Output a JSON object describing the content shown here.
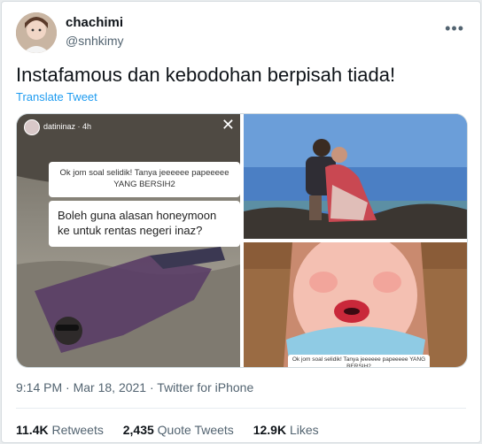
{
  "user": {
    "name": "chachimi",
    "handle": "@snhkimy"
  },
  "tweet": {
    "text": "Instafamous dan kebodohan berpisah tiada!",
    "translate_label": "Translate Tweet"
  },
  "media": {
    "left": {
      "story_user": "datininaz · 4h",
      "question_prompt": "Ok jom soal selidik! Tanya jeeeeee papeeeee YANG BERSIH2",
      "question_text": "Boleh guna alasan honeymoon ke untuk rentas negeri inaz?"
    },
    "bottom_right": {
      "caption": "Ok jom soal selidik! Tanya jeeeeee papeeeee YANG BERSIH2"
    }
  },
  "meta": {
    "time": "9:14 PM",
    "sep1": "·",
    "date": "Mar 18, 2021",
    "sep2": "·",
    "source": "Twitter for iPhone"
  },
  "stats": {
    "retweets": {
      "count": "11.4K",
      "label": "Retweets"
    },
    "quotes": {
      "count": "2,435",
      "label": "Quote Tweets"
    },
    "likes": {
      "count": "12.9K",
      "label": "Likes"
    }
  },
  "icons": {
    "more": "more-horizontal-icon"
  },
  "colors": {
    "link": "#1d9bf0",
    "text": "#0f1419",
    "secondary": "#536471"
  }
}
